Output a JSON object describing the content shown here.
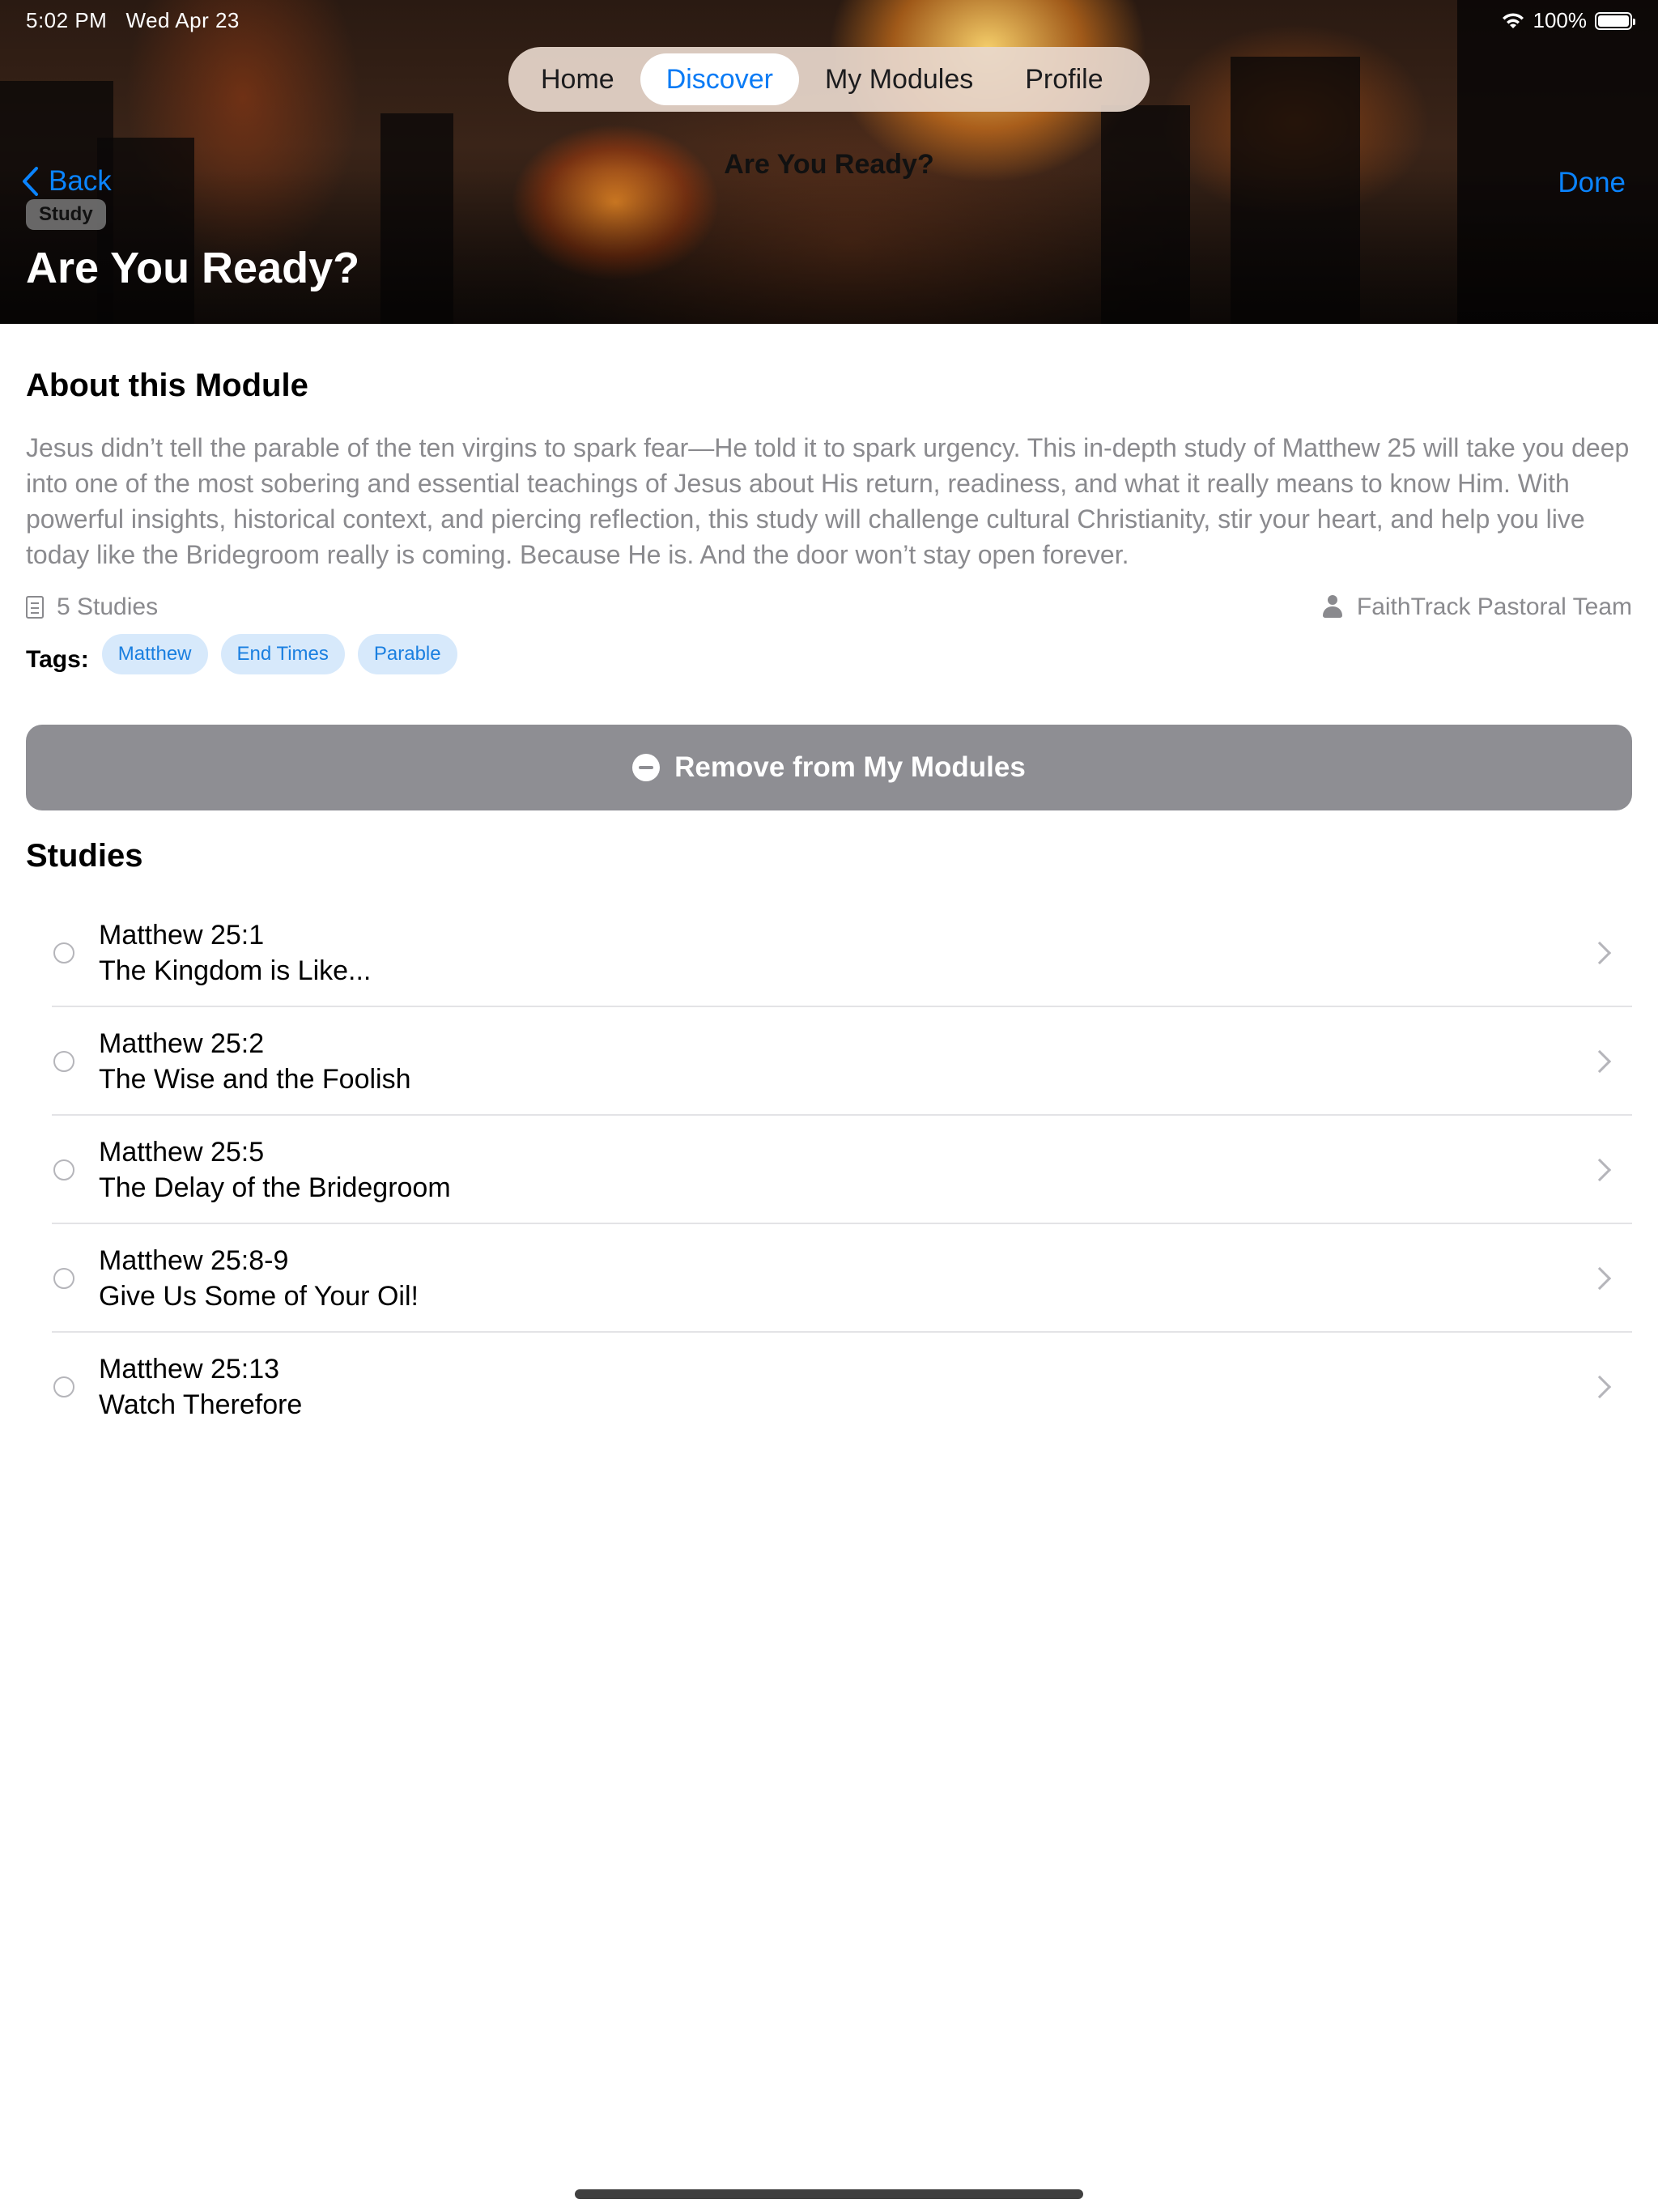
{
  "status_bar": {
    "time": "5:02 PM",
    "date": "Wed Apr 23",
    "battery": "100%",
    "battery_level": 1.0
  },
  "tabs": [
    {
      "label": "Home",
      "active": false
    },
    {
      "label": "Discover",
      "active": true
    },
    {
      "label": "My Modules",
      "active": false
    },
    {
      "label": "Profile",
      "active": false
    }
  ],
  "nav": {
    "back_label": "Back",
    "title": "Are You Ready?",
    "done_label": "Done"
  },
  "hero": {
    "badge": "Study",
    "title": "Are You Ready?"
  },
  "about": {
    "heading": "About this Module",
    "description": "Jesus didn’t tell the parable of the ten virgins to spark fear—He told it to spark urgency. This in-depth study of Matthew 25 will take you deep into one of the most sobering and essential teachings of Jesus about His return, readiness, and what it really means to know Him. With powerful insights, historical context, and piercing reflection, this study will challenge cultural Christianity, stir your heart, and help you live today like the Bridegroom really is coming. Because He is. And the door won’t stay open forever.",
    "study_count": "5 Studies",
    "author": "FaithTrack Pastoral Team"
  },
  "tags": {
    "label": "Tags:",
    "items": [
      "Matthew",
      "End Times",
      "Parable"
    ]
  },
  "remove_button": {
    "label": "Remove from My Modules"
  },
  "studies": {
    "heading": "Studies",
    "items": [
      {
        "reference": "Matthew 25:1",
        "title": "The Kingdom is Like..."
      },
      {
        "reference": "Matthew 25:2",
        "title": "The Wise and the Foolish"
      },
      {
        "reference": "Matthew 25:5",
        "title": "The Delay of the Bridegroom"
      },
      {
        "reference": "Matthew 25:8-9",
        "title": "Give Us Some of Your Oil!"
      },
      {
        "reference": "Matthew 25:13",
        "title": "Watch Therefore"
      }
    ]
  },
  "colors": {
    "accent": "#0a84ff",
    "tag_bg": "#d7e9fb",
    "remove_button_bg": "#8e8e93"
  }
}
